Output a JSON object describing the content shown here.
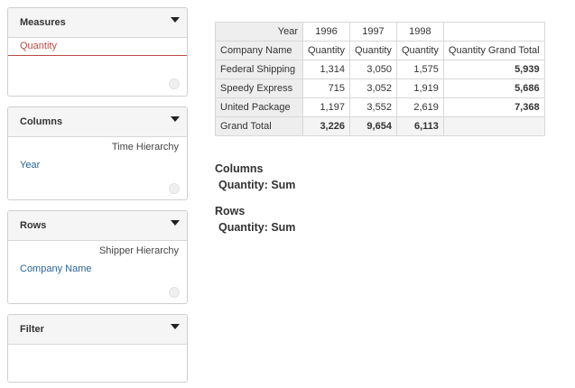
{
  "panels": {
    "measures": {
      "title": "Measures",
      "items": [
        "Quantity"
      ]
    },
    "columns": {
      "title": "Columns",
      "hierarchy": "Time Hierarchy",
      "items": [
        "Year"
      ]
    },
    "rows": {
      "title": "Rows",
      "hierarchy": "Shipper Hierarchy",
      "items": [
        "Company Name"
      ]
    },
    "filter": {
      "title": "Filter"
    }
  },
  "pivot": {
    "year_label": "Year",
    "years": [
      "1996",
      "1997",
      "1998"
    ],
    "row_header": "Company Name",
    "measure_label": "Quantity",
    "grand_total_col_label": "Quantity Grand Total",
    "rows": [
      {
        "name": "Federal Shipping",
        "values": [
          "1,314",
          "3,050",
          "1,575"
        ],
        "total": "5,939"
      },
      {
        "name": "Speedy Express",
        "values": [
          "715",
          "3,052",
          "1,919"
        ],
        "total": "5,686"
      },
      {
        "name": "United Package",
        "values": [
          "1,197",
          "3,552",
          "2,619"
        ],
        "total": "7,368"
      }
    ],
    "grand_total": {
      "label": "Grand Total",
      "values": [
        "3,226",
        "9,654",
        "6,113"
      ],
      "total": ""
    }
  },
  "summary": {
    "columns_heading": "Columns",
    "columns_detail": "Quantity: Sum",
    "rows_heading": "Rows",
    "rows_detail": "Quantity: Sum"
  }
}
